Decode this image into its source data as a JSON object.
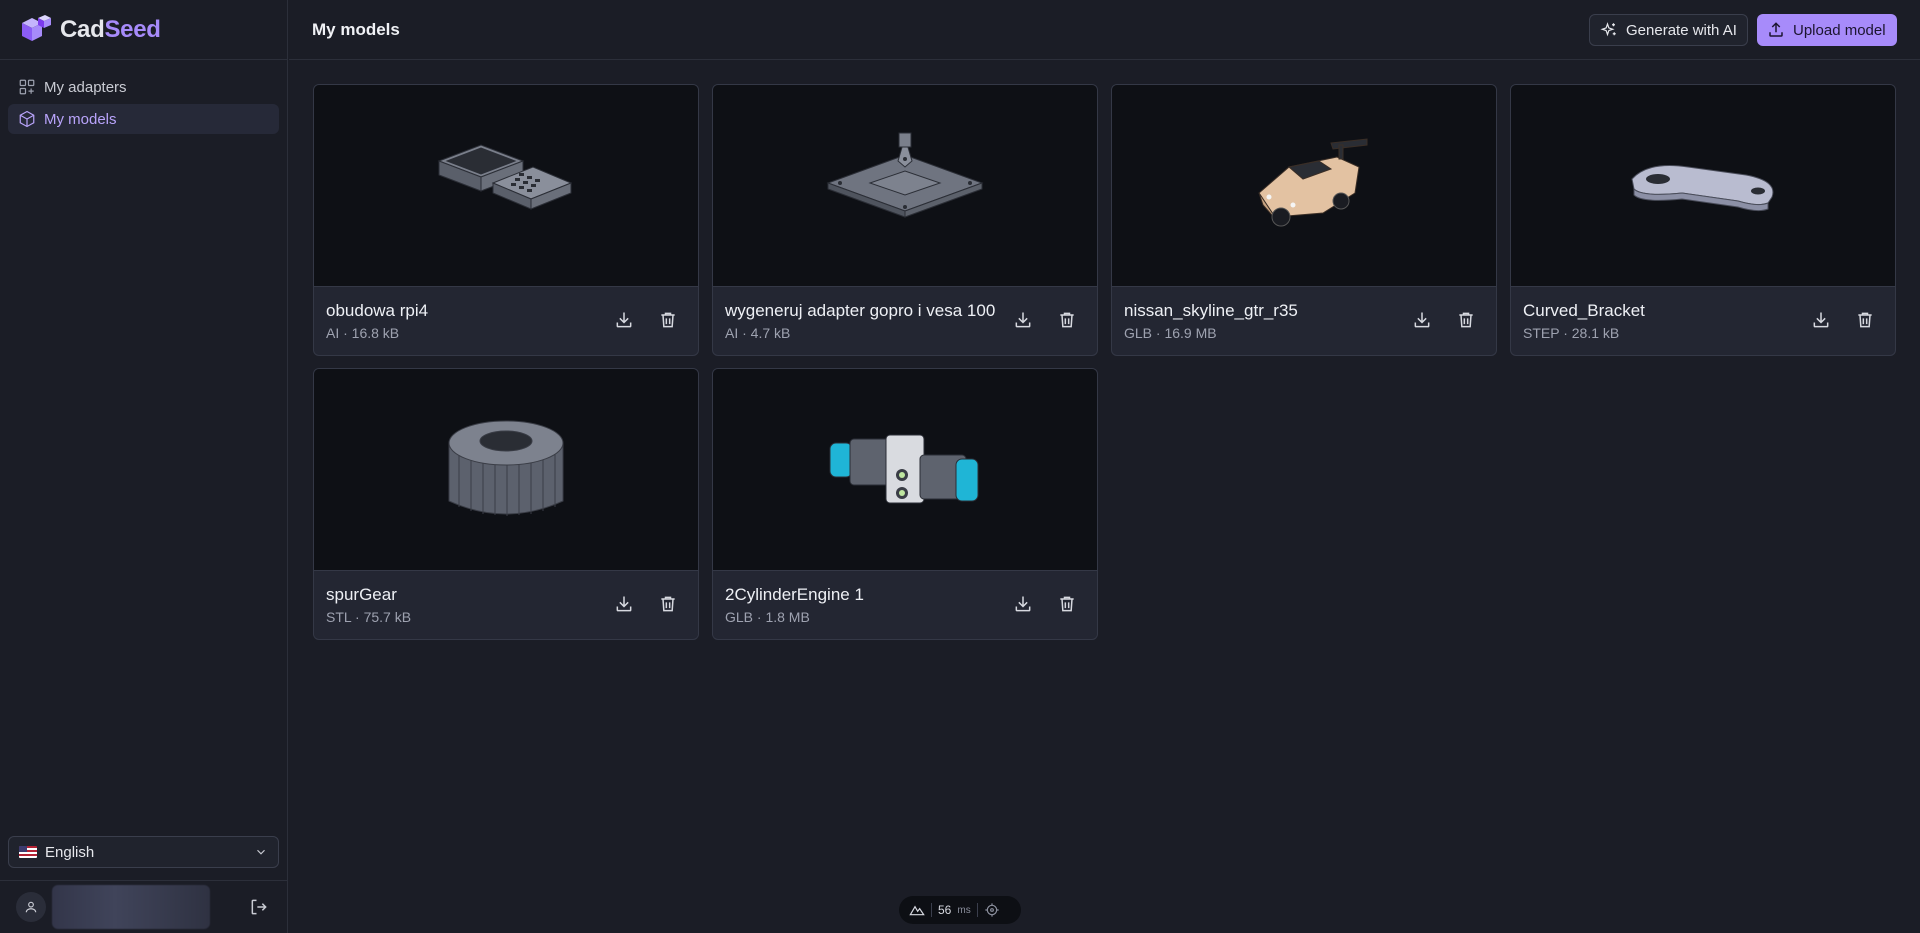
{
  "brand": {
    "name_part1": "Cad",
    "name_part2": "Seed"
  },
  "sidebar": {
    "items": [
      {
        "label": "My adapters",
        "icon": "grid-plus-icon",
        "active": false
      },
      {
        "label": "My models",
        "icon": "cube-icon",
        "active": true
      }
    ],
    "language": {
      "selected": "English",
      "flag": "us-flag-icon"
    }
  },
  "header": {
    "title": "My models",
    "generate_label": "Generate with AI",
    "upload_label": "Upload model"
  },
  "models": [
    {
      "name": "obudowa rpi4",
      "meta": "AI · 16.8 kB",
      "preview": "enclosure"
    },
    {
      "name": "wygeneruj adapter gopro i vesa 100",
      "meta": "AI · 4.7 kB",
      "preview": "plate"
    },
    {
      "name": "nissan_skyline_gtr_r35",
      "meta": "GLB · 16.9 MB",
      "preview": "car"
    },
    {
      "name": "Curved_Bracket",
      "meta": "STEP · 28.1 kB",
      "preview": "bracket"
    },
    {
      "name": "spurGear",
      "meta": "STL · 75.7 kB",
      "preview": "gear"
    },
    {
      "name": "2CylinderEngine 1",
      "meta": "GLB · 1.8 MB",
      "preview": "engine"
    }
  ],
  "devtool": {
    "value": "56",
    "unit": "ms"
  },
  "colors": {
    "accent": "#a78bfa",
    "background": "#1b1d26",
    "card": "#232632"
  }
}
